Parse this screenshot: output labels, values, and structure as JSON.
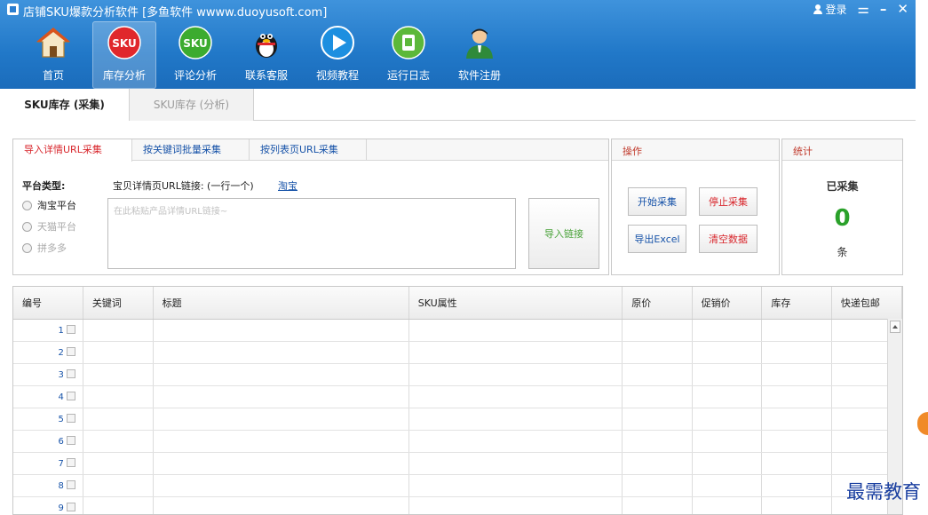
{
  "window": {
    "title": "店铺SKU爆款分析软件 [多鱼软件 wwww.duoyusoft.com]",
    "login": "登录",
    "menu_glyph": "⚌",
    "minimize_glyph": "–",
    "close_glyph": "✕"
  },
  "nav": [
    {
      "label": "首页",
      "icon": "home-icon"
    },
    {
      "label": "库存分析",
      "icon": "sku-red-icon",
      "active": true
    },
    {
      "label": "评论分析",
      "icon": "sku-green-icon"
    },
    {
      "label": "联系客服",
      "icon": "qq-penguin-icon"
    },
    {
      "label": "视频教程",
      "icon": "play-icon"
    },
    {
      "label": "运行日志",
      "icon": "log-icon"
    },
    {
      "label": "软件注册",
      "icon": "user-register-icon"
    }
  ],
  "nav_icon_text": {
    "sku": "SKU"
  },
  "subtabs": {
    "active": "SKU库存 (采集)",
    "inactive": "SKU库存 (分析)"
  },
  "import": {
    "tabs": [
      "导入详情URL采集",
      "按关键词批量采集",
      "按列表页URL采集"
    ],
    "platform_label": "平台类型:",
    "platforms": [
      "淘宝平台",
      "天猫平台",
      "拼多多"
    ],
    "url_label": "宝贝详情页URL链接: (一行一个)",
    "url_link": "淘宝",
    "url_placeholder": "在此粘贴产品详情URL链接~",
    "url_value": "",
    "import_button": "导入链接"
  },
  "ops": {
    "title": "操作",
    "start": "开始采集",
    "stop": "停止采集",
    "export": "导出Excel",
    "clear": "清空数据"
  },
  "stats": {
    "title": "统计",
    "caption": "已采集",
    "count": "0",
    "unit": "条"
  },
  "table": {
    "columns": [
      "编号",
      "关键词",
      "标题",
      "SKU属性",
      "原价",
      "促销价",
      "库存",
      "快递包邮"
    ],
    "row_numbers": [
      "1",
      "2",
      "3",
      "4",
      "5",
      "6",
      "7",
      "8",
      "9"
    ]
  },
  "watermark": "最需教育",
  "colors": {
    "header_blue": "#2178c8",
    "accent_red": "#d8262c",
    "link_blue": "#1652a8",
    "success_green": "#2aa12a"
  }
}
